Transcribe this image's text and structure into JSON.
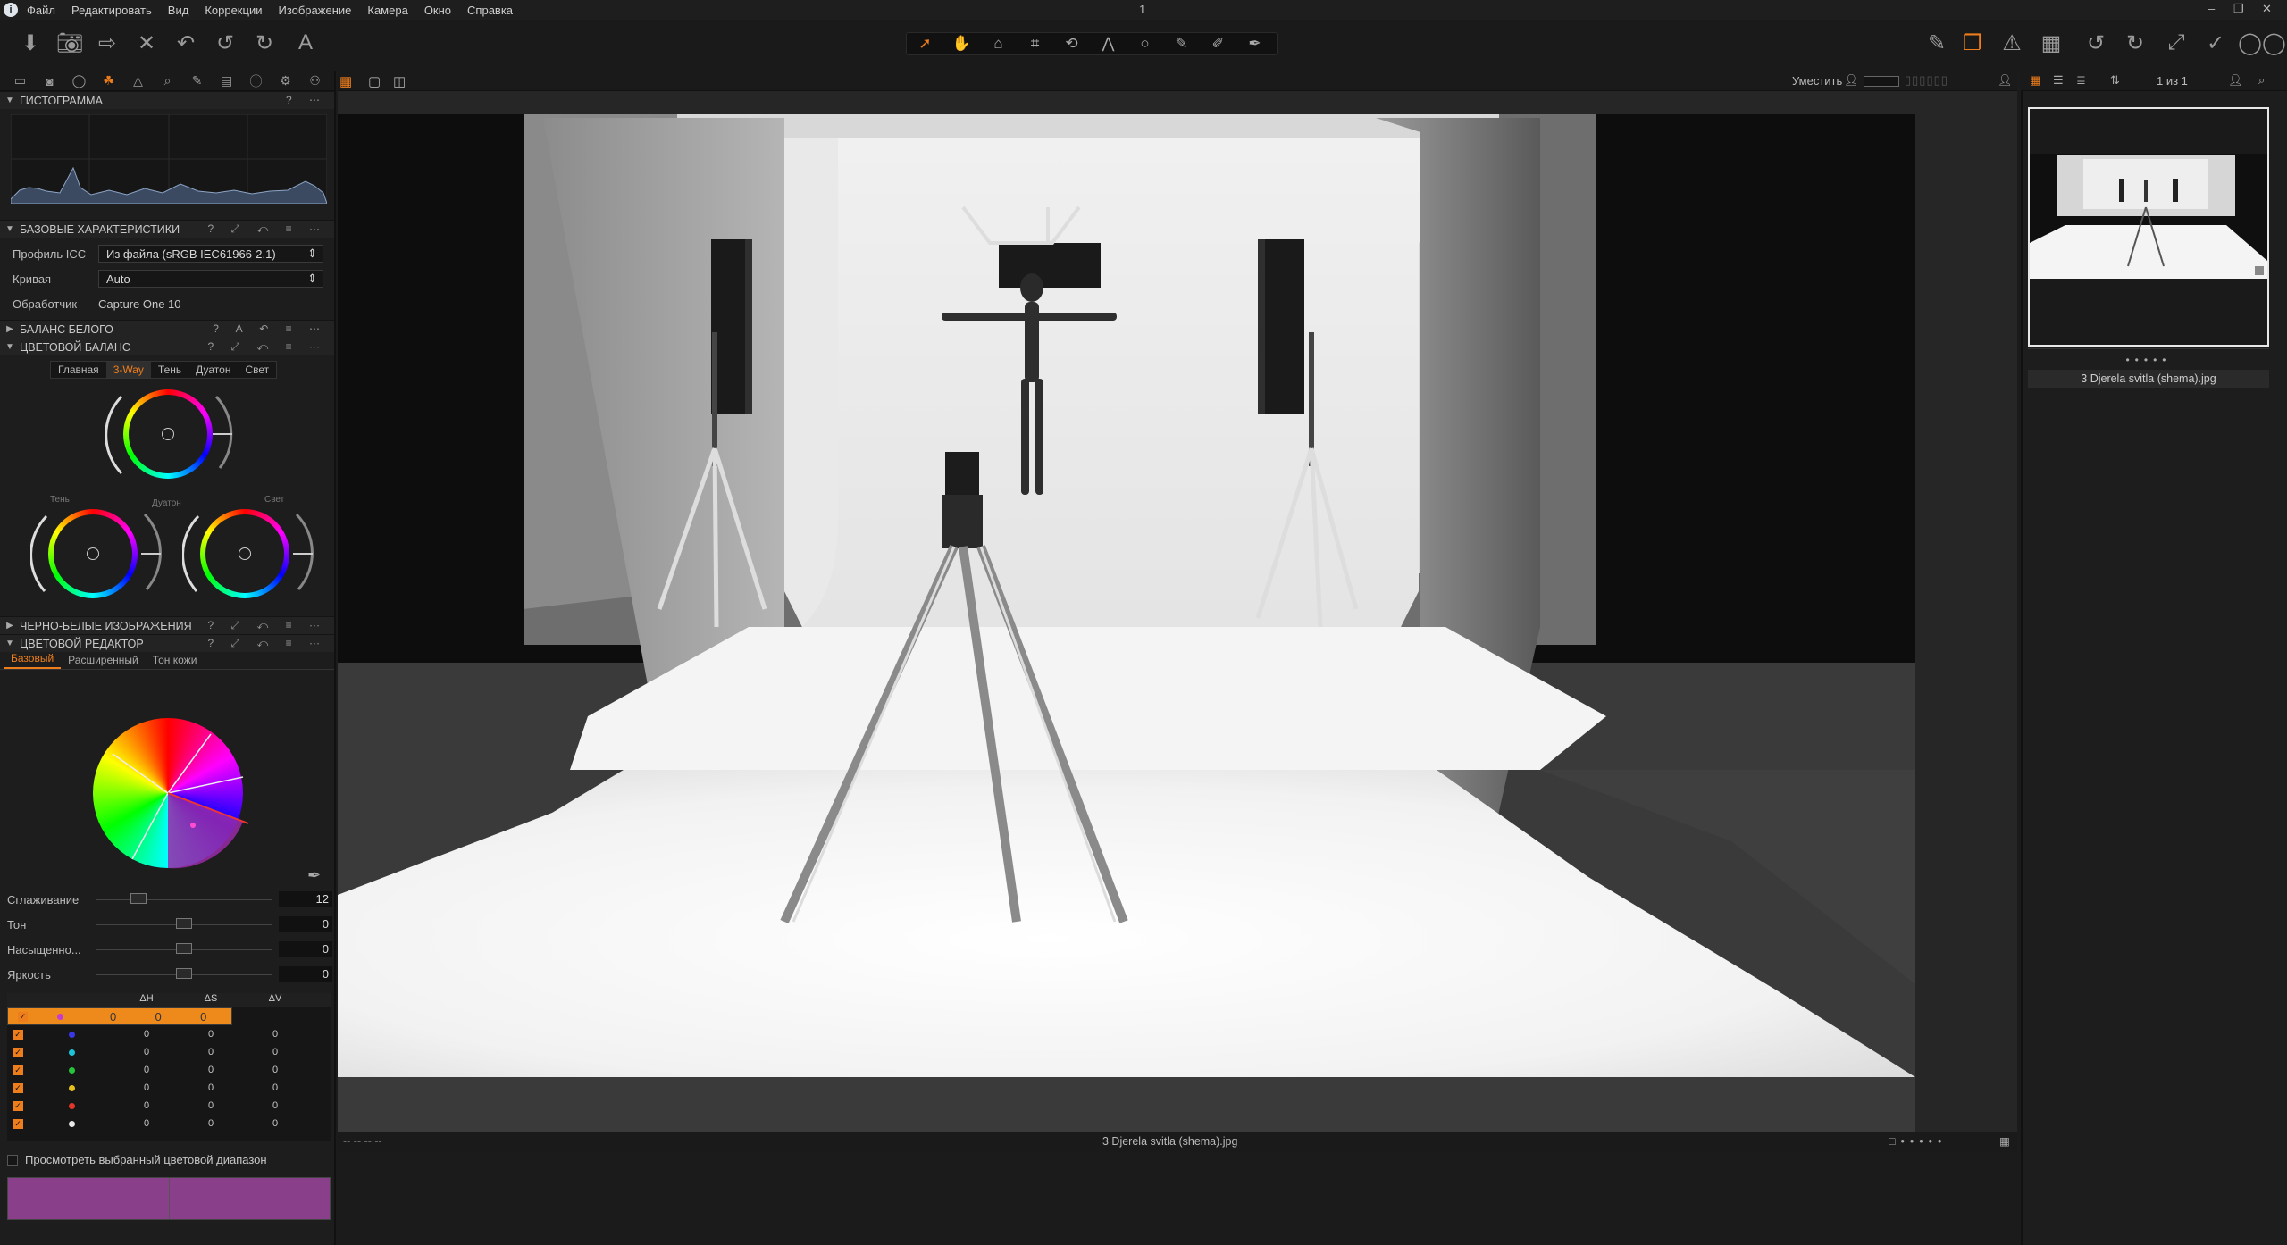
{
  "menubar": {
    "items": [
      "Файл",
      "Редактировать",
      "Вид",
      "Коррекции",
      "Изображение",
      "Камера",
      "Окно",
      "Справка"
    ],
    "title": "1"
  },
  "toolbar": {
    "left_icons": [
      "import-icon",
      "camera-icon",
      "export-icon",
      "delete-icon",
      "undo-icon",
      "undo-alt-icon",
      "redo-icon",
      "text-icon"
    ],
    "center_icons": [
      "cursor-icon",
      "pan-icon",
      "loupe-icon",
      "crop-icon",
      "rotate-icon",
      "keystone-icon",
      "spot-icon",
      "brush-icon",
      "eraser-icon",
      "picker-icon"
    ],
    "right_icons": [
      "edit-icon",
      "layers-icon",
      "warning-icon",
      "grid-icon",
      "rotate-left-icon",
      "rotate-right-icon",
      "expand-icon",
      "check-icon",
      "glasses-icon"
    ]
  },
  "left": {
    "histogram_title": "ГИСТОГРАММА",
    "basic_title": "БАЗОВЫЕ ХАРАКТЕРИСТИКИ",
    "icc_label": "Профиль ICC",
    "icc_value": "Из файла (sRGB IEC61966-2.1)",
    "curve_label": "Кривая",
    "curve_value": "Auto",
    "processor_label": "Обработчик",
    "processor_value": "Capture One 10",
    "wb_title": "БАЛАНС БЕЛОГО",
    "cb_title": "ЦВЕТОВОЙ БАЛАНС",
    "cb_tabs": [
      "Главная",
      "3-Way",
      "Тень",
      "Дуатон",
      "Свет"
    ],
    "cb_active_tab": "3-Way",
    "wheel_labels": {
      "shadow": "Тень",
      "midtone": "Дуатон",
      "highlight": "Свет"
    },
    "bw_title": "ЧЕРНО-БЕЛЫЕ ИЗОБРАЖЕНИЯ",
    "ce_title": "ЦВЕТОВОЙ РЕДАКТОР",
    "ce_tabs": [
      "Базовый",
      "Расширенный",
      "Тон кожи"
    ],
    "sliders": [
      {
        "label": "Сглаживание",
        "value": "12",
        "pos": 0.24
      },
      {
        "label": "Тон",
        "value": "0",
        "pos": 0.5
      },
      {
        "label": "Насыщенно...",
        "value": "0",
        "pos": 0.5
      },
      {
        "label": "Яркость",
        "value": "0",
        "pos": 0.5
      }
    ],
    "table_headers": [
      "",
      "ΔH",
      "ΔS",
      "ΔV"
    ],
    "table_rows": [
      {
        "color": "#c43bd2",
        "h": "0",
        "s": "0",
        "v": "0",
        "selected": true
      },
      {
        "color": "#3a37e6",
        "h": "0",
        "s": "0",
        "v": "0",
        "selected": false
      },
      {
        "color": "#1fc3d9",
        "h": "0",
        "s": "0",
        "v": "0",
        "selected": false
      },
      {
        "color": "#27c43b",
        "h": "0",
        "s": "0",
        "v": "0",
        "selected": false
      },
      {
        "color": "#e3c21b",
        "h": "0",
        "s": "0",
        "v": "0",
        "selected": false
      },
      {
        "color": "#e2362a",
        "h": "0",
        "s": "0",
        "v": "0",
        "selected": false
      },
      {
        "color": "#e8e8e8",
        "h": "0",
        "s": "0",
        "v": "0",
        "selected": false
      }
    ],
    "view_range_label": "Просмотреть выбранный цветовой диапазон",
    "swatch_color": "#8a3f8a"
  },
  "viewer": {
    "fit_label": "Уместить",
    "filename": "3 Djerela svitla (shema).jpg"
  },
  "browser": {
    "count": "1 из 1",
    "filename": "3 Djerela svitla (shema).jpg"
  },
  "colors": {
    "accent": "#ee7d1c",
    "bg": "#1b1b1b"
  }
}
